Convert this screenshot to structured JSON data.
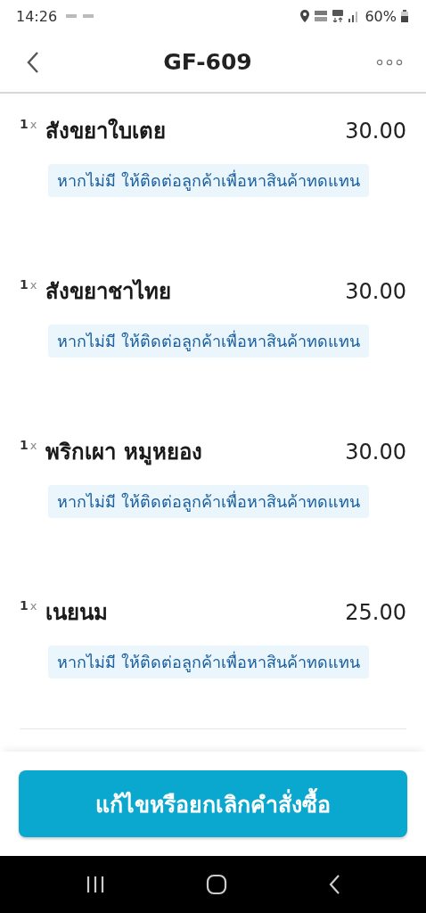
{
  "status_bar": {
    "time": "14:26",
    "battery": "60%"
  },
  "header": {
    "title": "GF-609"
  },
  "items": [
    {
      "quantity": "1",
      "times": "x",
      "name": "สังขยาใบเตย",
      "price": "30.00",
      "note": "หากไม่มี ให้ติดต่อลูกค้าเพื่อหาสินค้าทดแทน"
    },
    {
      "quantity": "1",
      "times": "x",
      "name": "สังขยาชาไทย",
      "price": "30.00",
      "note": "หากไม่มี ให้ติดต่อลูกค้าเพื่อหาสินค้าทดแทน"
    },
    {
      "quantity": "1",
      "times": "x",
      "name": "พริกเผา หมูหยอง",
      "price": "30.00",
      "note": "หากไม่มี ให้ติดต่อลูกค้าเพื่อหาสินค้าทดแทน"
    },
    {
      "quantity": "1",
      "times": "x",
      "name": "เนยนม",
      "price": "25.00",
      "note": "หากไม่มี ให้ติดต่อลูกค้าเพื่อหาสินค้าทดแทน"
    }
  ],
  "action_button": {
    "label": "แก้ไขหรือยกเลิกคำสั่งซื้อ"
  }
}
